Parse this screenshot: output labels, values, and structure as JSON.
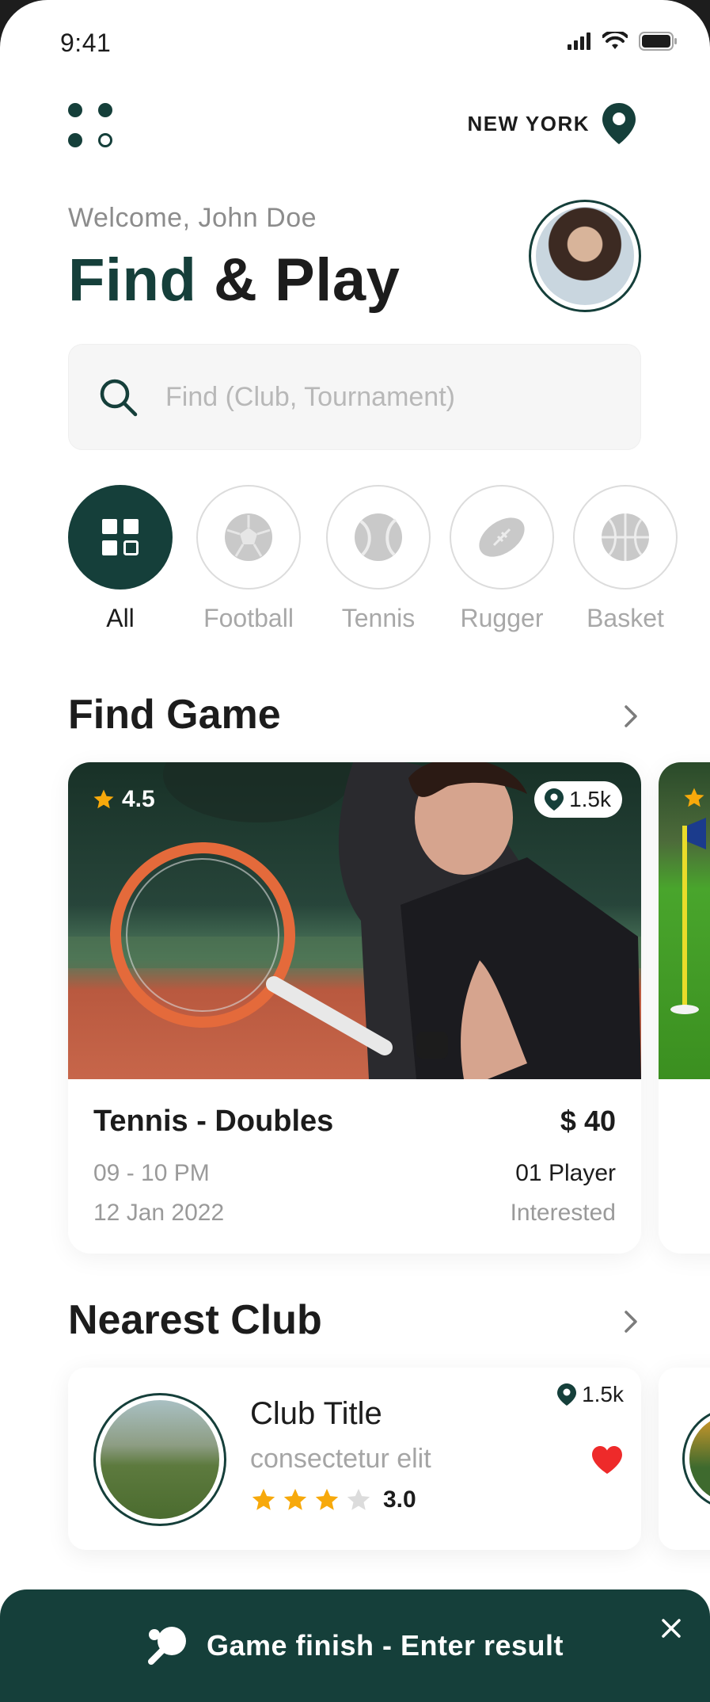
{
  "status_bar": {
    "time": "9:41"
  },
  "header": {
    "location": "NEW YORK"
  },
  "greeting": {
    "welcome": "Welcome, John Doe",
    "title_part1": "Find",
    "title_part2": "& Play"
  },
  "search": {
    "placeholder": "Find (Club, Tournament)"
  },
  "categories": [
    {
      "label": "All",
      "icon": "grid-icon",
      "active": true
    },
    {
      "label": "Football",
      "icon": "football-icon",
      "active": false
    },
    {
      "label": "Tennis",
      "icon": "tennis-ball-icon",
      "active": false
    },
    {
      "label": "Rugger",
      "icon": "rugby-ball-icon",
      "active": false
    },
    {
      "label": "Basket",
      "icon": "basketball-icon",
      "active": false
    }
  ],
  "find_game": {
    "title": "Find Game",
    "card": {
      "rating": "4.5",
      "distance": "1.5k",
      "title": "Tennis - Doubles",
      "price": "$ 40",
      "time": "09 - 10 PM",
      "date": "12 Jan 2022",
      "players": "01 Player",
      "status": "Interested"
    }
  },
  "nearest_club": {
    "title": "Nearest Club",
    "card": {
      "title": "Club Title",
      "subtitle": "consectetur elit",
      "rating": "3.0",
      "rating_value": 3,
      "distance": "1.5k"
    }
  },
  "toast": {
    "message": "Game finish - Enter result"
  },
  "colors": {
    "primary": "#153f3a",
    "star": "#f7a90b",
    "heart": "#ee2a2a",
    "muted": "#a5a5a5"
  }
}
